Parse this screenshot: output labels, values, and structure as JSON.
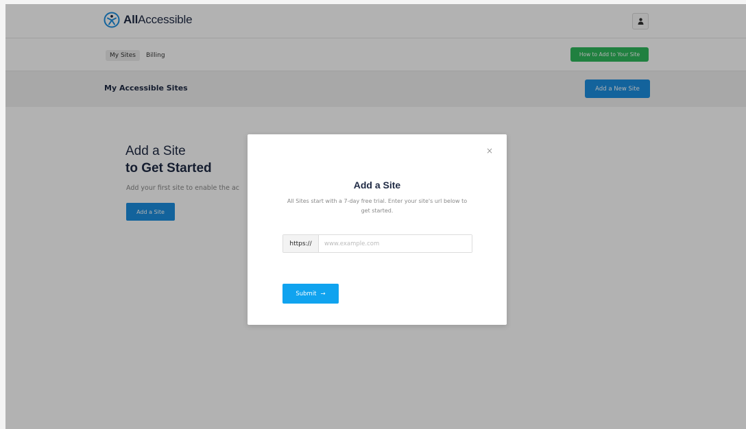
{
  "header": {
    "brand_bold": "All",
    "brand_rest": "Accessible",
    "user_icon": "user-icon"
  },
  "nav": {
    "tabs": [
      {
        "label": "My Sites",
        "active": true
      },
      {
        "label": "Billing",
        "active": false
      }
    ],
    "how_to_label": "How to Add to Your Site"
  },
  "titlebar": {
    "title": "My Accessible Sites",
    "new_site_label": "Add a New Site"
  },
  "hero": {
    "title_line1": "Add a Site",
    "title_line2": "to Get Started",
    "subtitle": "Add your first site to enable the ac",
    "button_label": "Add a Site"
  },
  "modal": {
    "close_glyph": "×",
    "title": "Add a Site",
    "description": "All Sites start with a 7-day free trial. Enter your site's url below to get started.",
    "url_prefix": "https://",
    "url_placeholder": "www.example.com",
    "url_value": "",
    "submit_label": "Submit",
    "submit_arrow": "→"
  },
  "colors": {
    "primary_blue": "#1c8fe0",
    "submit_blue": "#10a3ef",
    "green": "#2eb85c",
    "navy_text": "#1f2a44"
  }
}
